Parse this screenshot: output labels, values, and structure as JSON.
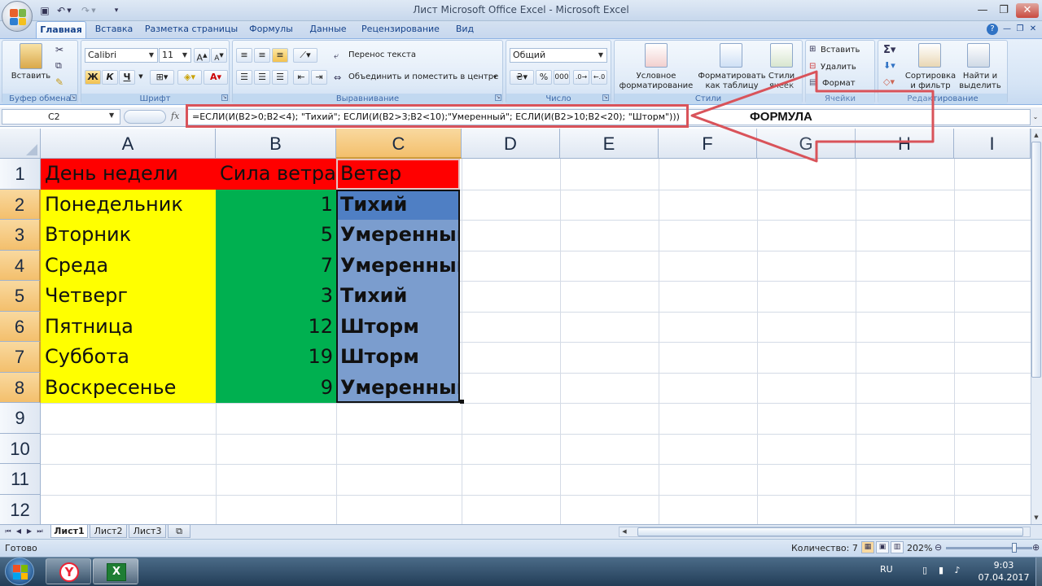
{
  "window": {
    "title": "Лист Microsoft Office Excel - Microsoft Excel"
  },
  "ribbon": {
    "tabs": [
      "Главная",
      "Вставка",
      "Разметка страницы",
      "Формулы",
      "Данные",
      "Рецензирование",
      "Вид"
    ],
    "active_tab": "Главная",
    "clipboard": {
      "paste": "Вставить",
      "label": "Буфер обмена"
    },
    "font": {
      "name": "Calibri",
      "size": "11",
      "bold": "Ж",
      "italic": "К",
      "underline": "Ч",
      "label": "Шрифт"
    },
    "alignment": {
      "wrap": "Перенос текста",
      "merge": "Объединить и поместить в центре",
      "label": "Выравнивание"
    },
    "number": {
      "format": "Общий",
      "percent": "%",
      "thousands": "000",
      "label": "Число"
    },
    "styles": {
      "conditional": "Условное форматирование",
      "as_table": "Форматировать как таблицу",
      "cell_styles": "Стили ячеек",
      "label": "Стили"
    },
    "cells": {
      "insert": "Вставить",
      "delete": "Удалить",
      "format": "Формат",
      "label": "Ячейки"
    },
    "editing": {
      "sort": "Сортировка и фильтр",
      "find": "Найти и выделить",
      "label": "Редактирование"
    }
  },
  "formula_bar": {
    "name_box": "C2",
    "fx": "fx",
    "formula": "=ЕСЛИ(И(B2>0;B2<4); \"Тихий\"; ЕСЛИ(И(B2>3;B2<10);\"Умеренный\"; ЕСЛИ(И(B2>10;B2<20); \"Шторм\")))",
    "annotation": "ФОРМУЛА"
  },
  "sheet": {
    "columns": [
      "A",
      "B",
      "C",
      "D",
      "E",
      "F",
      "G",
      "H",
      "I"
    ],
    "rows": [
      "1",
      "2",
      "3",
      "4",
      "5",
      "6",
      "7",
      "8",
      "9",
      "10",
      "11",
      "12"
    ],
    "headers": [
      "День недели",
      "Сила ветра",
      "Ветер"
    ],
    "data": [
      [
        "Понедельник",
        "1",
        "Тихий"
      ],
      [
        "Вторник",
        "5",
        "Умеренный"
      ],
      [
        "Среда",
        "7",
        "Умеренный"
      ],
      [
        "Четверг",
        "3",
        "Тихий"
      ],
      [
        "Пятница",
        "12",
        "Шторм"
      ],
      [
        "Суббота",
        "19",
        "Шторм"
      ],
      [
        "Воскресенье",
        "9",
        "Умеренный"
      ]
    ],
    "colors": {
      "header": "#ff0000",
      "col_a": "#ffff00",
      "col_b": "#00b050",
      "col_c": "#7b9dce",
      "col_c_active": "#4f7fc4"
    }
  },
  "sheet_tabs": [
    "Лист1",
    "Лист2",
    "Лист3"
  ],
  "status": {
    "ready": "Готово",
    "count": "Количество: 7",
    "zoom": "202%"
  },
  "taskbar": {
    "lang": "RU",
    "time": "9:03",
    "date": "07.04.2017"
  }
}
